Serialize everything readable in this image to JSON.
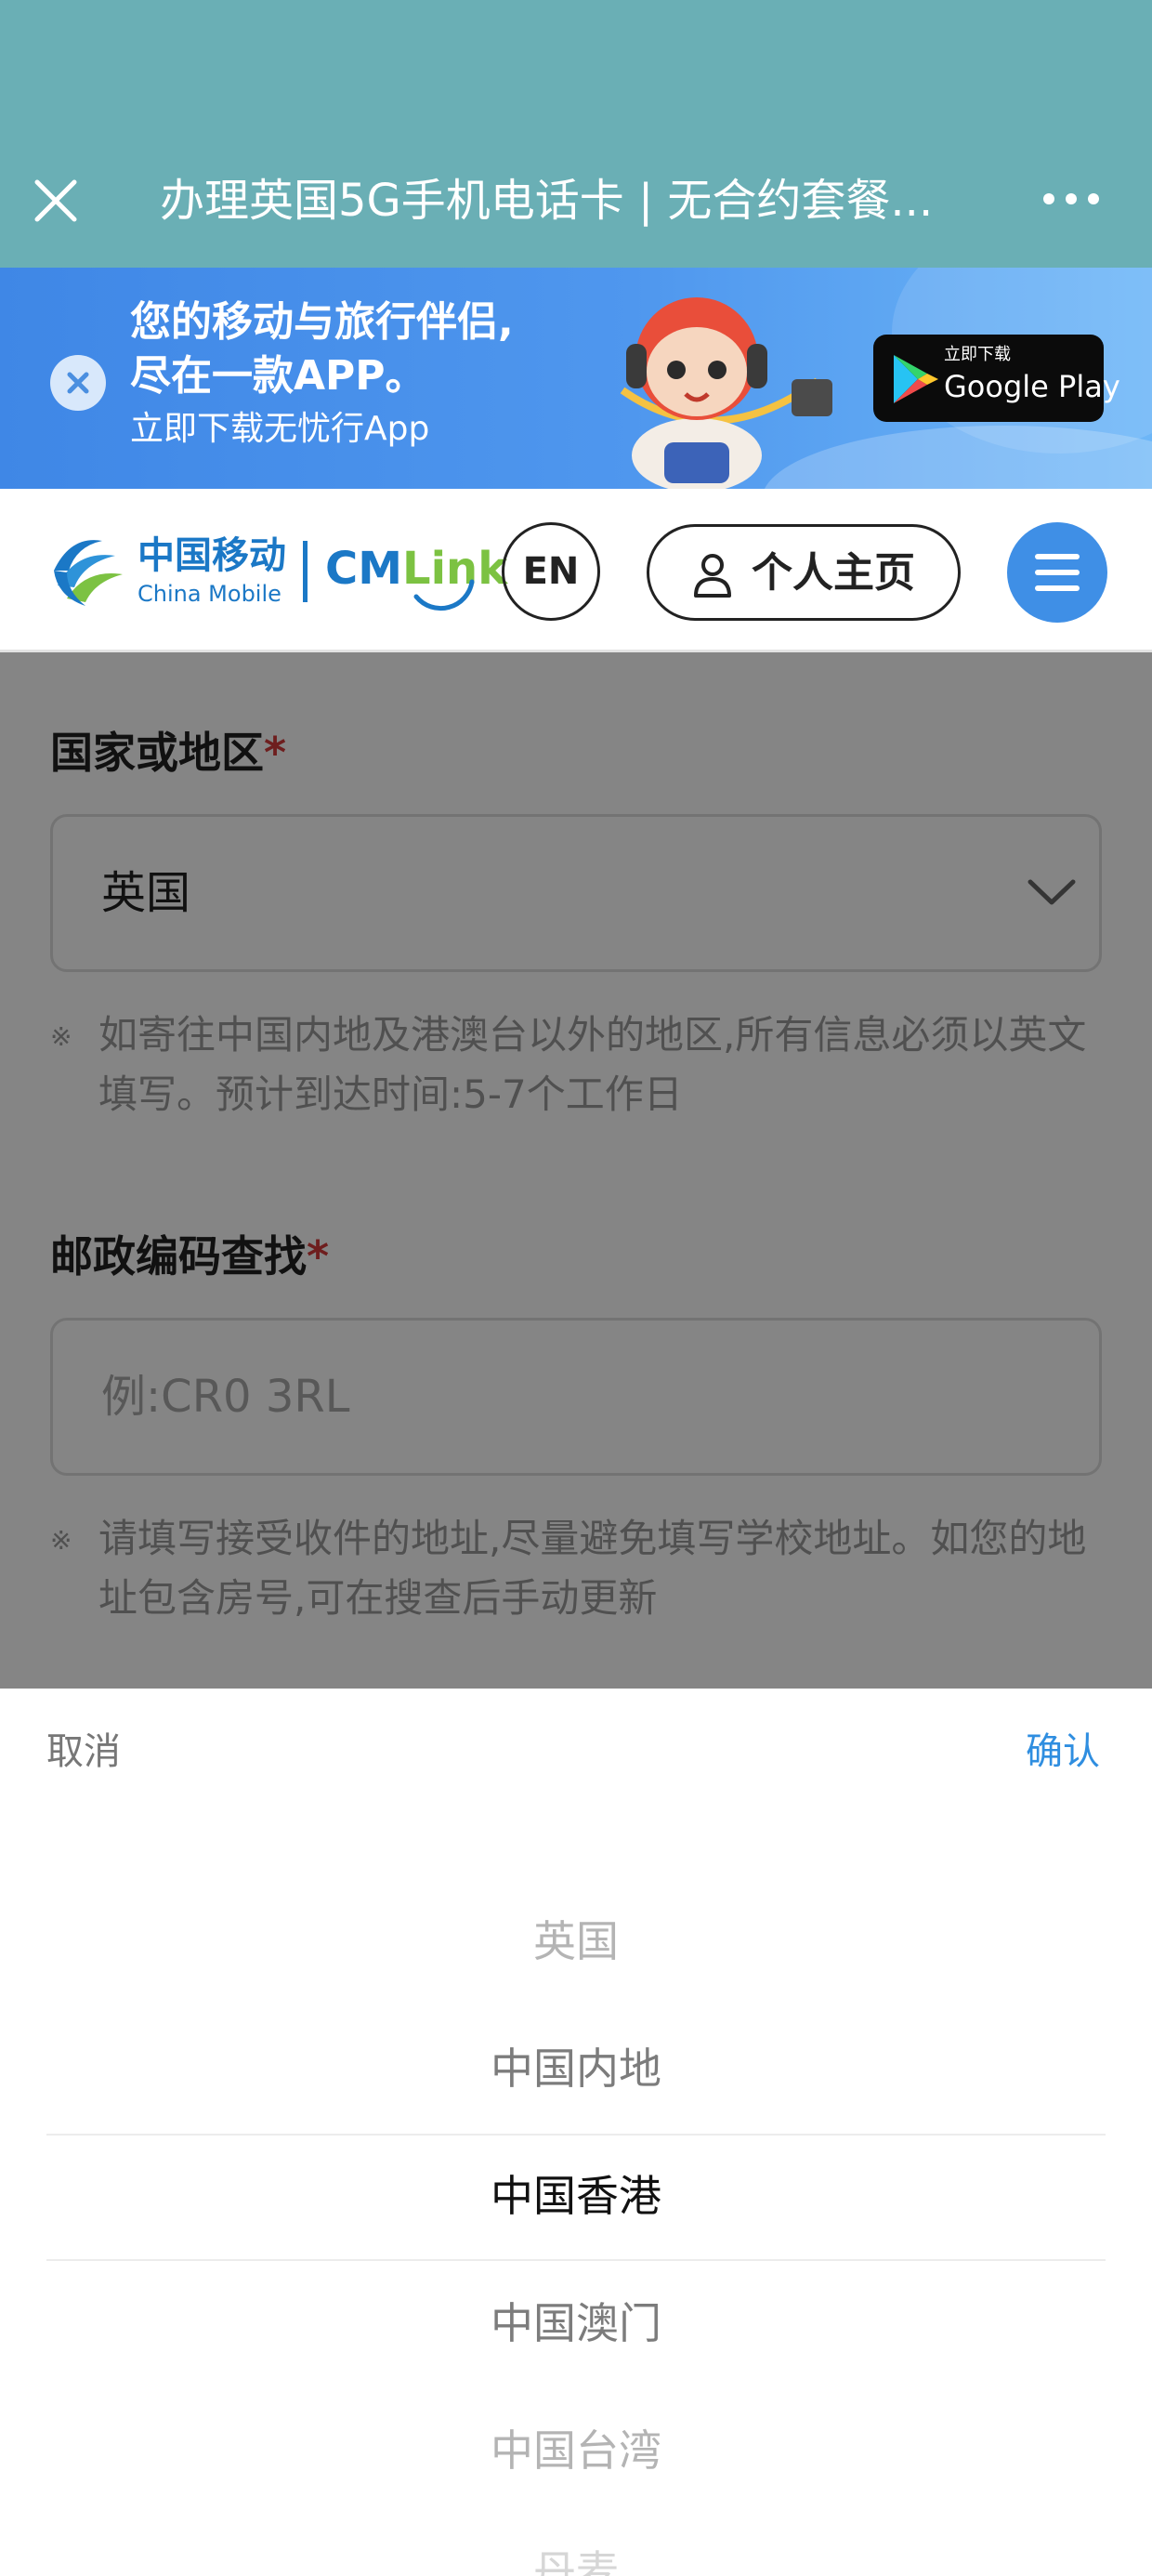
{
  "titlebar": {
    "title": "办理英国5G手机电话卡 | 无合约套餐..."
  },
  "banner": {
    "line1": "您的移动与旅行伴侣,",
    "line2": "尽在一款APP。",
    "line3": "立即下载无忧行App",
    "store_small": "立即下载",
    "store_big": "Google Play"
  },
  "header": {
    "logo_cn": "中国移动",
    "logo_en": "China Mobile",
    "brand_cm": "CM",
    "brand_link": "Link",
    "lang_label": "EN",
    "profile_label": "个人主页"
  },
  "form": {
    "country": {
      "label": "国家或地区",
      "required": "*",
      "value": "英国",
      "note_mark": "※",
      "note": "如寄往中国内地及港澳台以外的地区,所有信息必须以英文填写。预计到达时间:5-7个工作日"
    },
    "postcode": {
      "label": "邮政编码查找",
      "required": "*",
      "placeholder": "例:CR0 3RL",
      "note_mark": "※",
      "note": "请填写接受收件的地址,尽量避免填写学校地址。如您的地址包含房号,可在搜查后手动更新"
    }
  },
  "picker": {
    "cancel": "取消",
    "confirm": "确认",
    "options": [
      "英国",
      "中国内地",
      "中国香港",
      "中国澳门",
      "中国台湾",
      "丹麦"
    ],
    "selected": "中国香港"
  },
  "colors": {
    "titlebar": "#6aafb5",
    "brand_blue": "#1b78c6",
    "link_green": "#7cc242",
    "confirm_blue": "#2f8ee0",
    "required_red": "#d43a3a"
  },
  "icons": [
    "close-icon",
    "more-icon",
    "dismiss-icon",
    "google-play-icon",
    "china-mobile-logo-icon",
    "person-icon",
    "menu-icon",
    "chevron-down-icon"
  ]
}
